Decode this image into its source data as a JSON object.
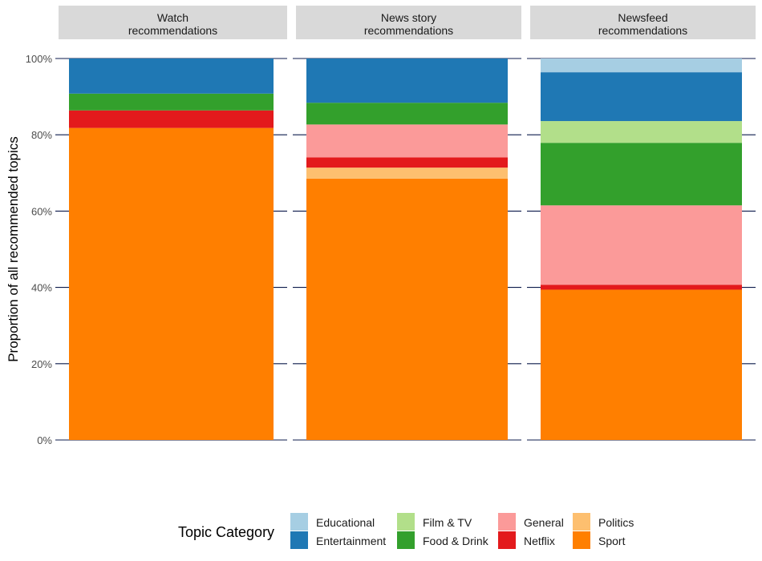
{
  "chart_data": {
    "type": "bar",
    "stacked": true,
    "facets": [
      "Watch\nrecommendations",
      "News story\nrecommendations",
      "Newsfeed\nrecommendations"
    ],
    "ylabel": "Proportion of all recommended topics",
    "xlabel": "",
    "ylim": [
      0,
      1
    ],
    "yticks": [
      0,
      0.2,
      0.4,
      0.6,
      0.8,
      1.0
    ],
    "ytick_labels": [
      "0%",
      "20%",
      "40%",
      "60%",
      "80%",
      "100%"
    ],
    "grid": "horizontal major",
    "legend": {
      "title": "Topic Category",
      "position": "bottom",
      "entries": [
        {
          "name": "Educational",
          "color": "#a6cee3"
        },
        {
          "name": "Entertainment",
          "color": "#1f78b4"
        },
        {
          "name": "Film & TV",
          "color": "#b2df8a"
        },
        {
          "name": "Food & Drink",
          "color": "#33a02c"
        },
        {
          "name": "General",
          "color": "#fb9a99"
        },
        {
          "name": "Netflix",
          "color": "#e31a1c"
        },
        {
          "name": "Politics",
          "color": "#fdbf6f"
        },
        {
          "name": "Sport",
          "color": "#ff7f00"
        }
      ]
    },
    "stack_order_bottom_to_top": [
      "Sport",
      "Politics",
      "Netflix",
      "General",
      "Food & Drink",
      "Film & TV",
      "Entertainment",
      "Educational"
    ],
    "series": [
      {
        "name": "Educational",
        "values": [
          0.0,
          0.0,
          0.036
        ]
      },
      {
        "name": "Entertainment",
        "values": [
          0.092,
          0.116,
          0.128
        ]
      },
      {
        "name": "Film & TV",
        "values": [
          0.0,
          0.0,
          0.057
        ]
      },
      {
        "name": "Food & Drink",
        "values": [
          0.044,
          0.057,
          0.164
        ]
      },
      {
        "name": "General",
        "values": [
          0.0,
          0.086,
          0.208
        ]
      },
      {
        "name": "Netflix",
        "values": [
          0.046,
          0.027,
          0.013
        ]
      },
      {
        "name": "Politics",
        "values": [
          0.0,
          0.029,
          0.0
        ]
      },
      {
        "name": "Sport",
        "values": [
          0.818,
          0.685,
          0.394
        ]
      }
    ],
    "colors": {
      "strip_bg": "#d9d9d9",
      "gridline": "#0d1b4c"
    }
  }
}
